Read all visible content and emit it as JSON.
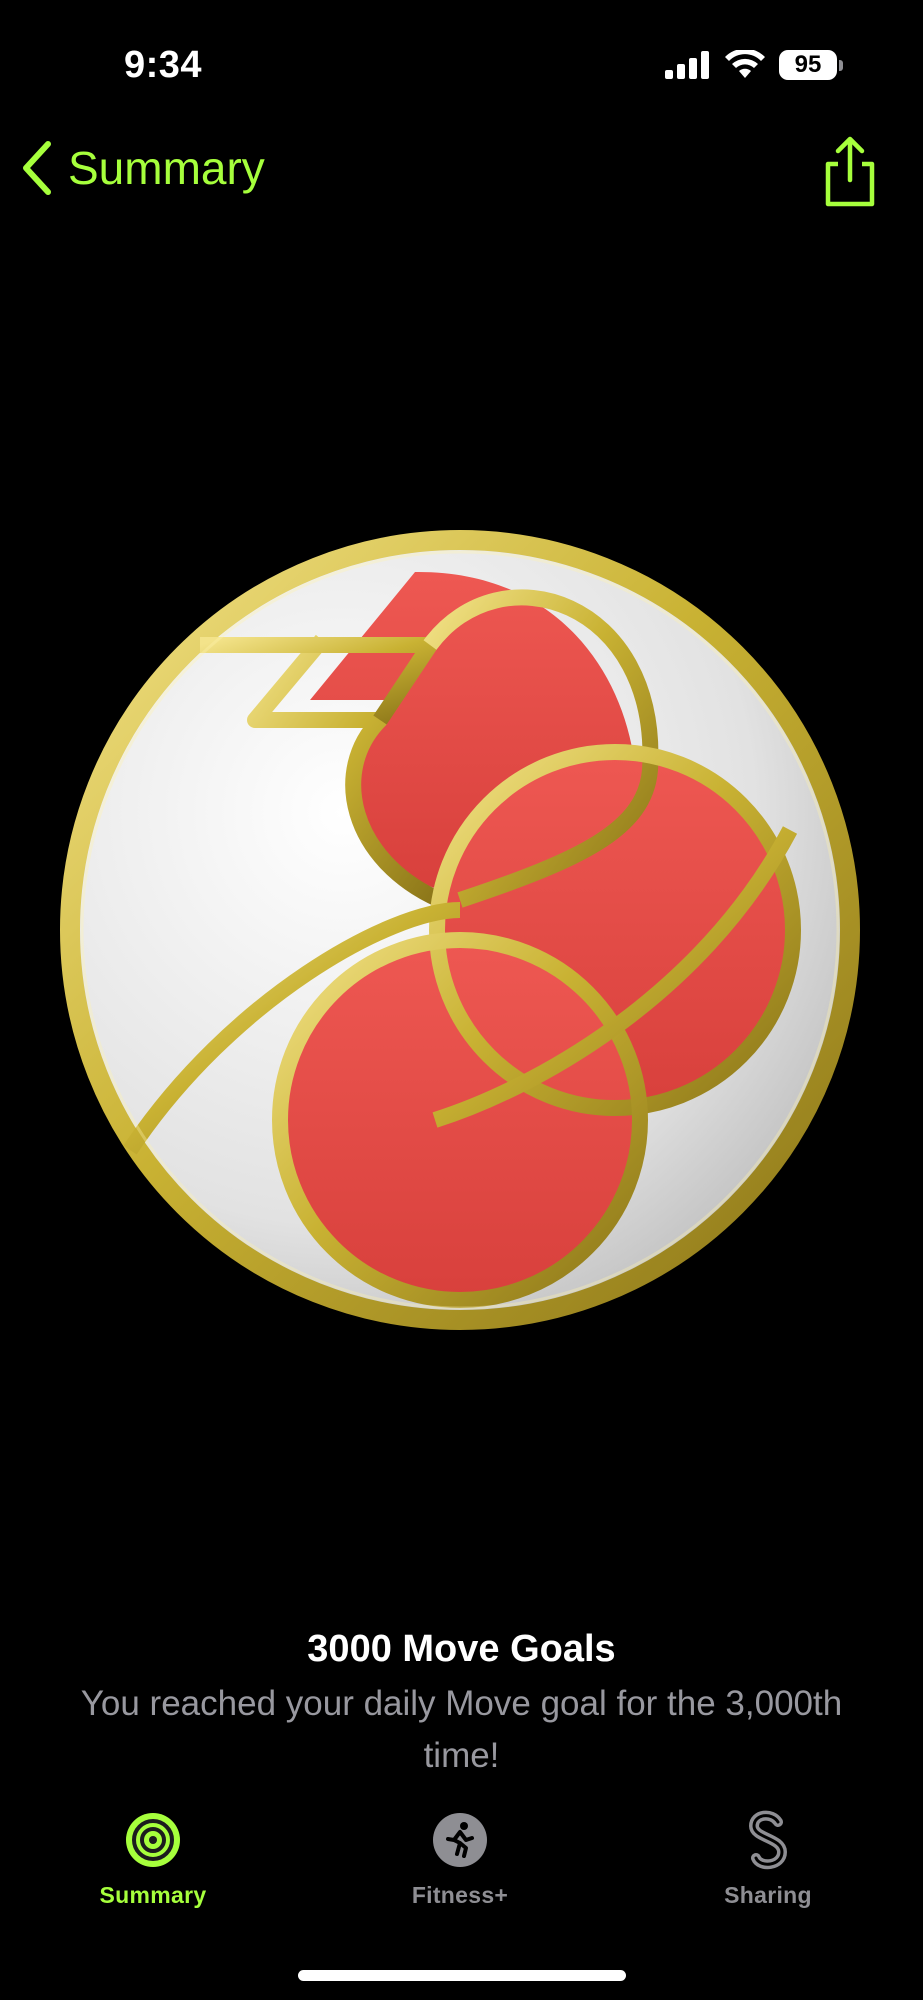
{
  "status_bar": {
    "time": "9:34",
    "battery_level": "95",
    "icons": [
      "signal-icon",
      "wifi-icon",
      "battery-icon"
    ]
  },
  "nav": {
    "back_label": "Summary",
    "back_icon": "chevron-left-icon",
    "share_icon": "share-icon"
  },
  "award": {
    "icon": "move-goals-award-badge",
    "title": "3000 Move Goals",
    "description": "You reached your daily Move goal for the 3,000th time!"
  },
  "tabs": [
    {
      "label": "Summary",
      "icon": "activity-rings-icon",
      "selected": true
    },
    {
      "label": "Fitness+",
      "icon": "running-figure-icon",
      "selected": false
    },
    {
      "label": "Sharing",
      "icon": "sharing-icon",
      "selected": false
    }
  ],
  "colors": {
    "accent": "#a6ff3c",
    "background": "#000000",
    "secondary_text": "#98989f",
    "tab_inactive": "#8e8e93",
    "badge_red": "#e8504a",
    "badge_gold": "#c9b233",
    "badge_white": "#e8e8e8"
  }
}
